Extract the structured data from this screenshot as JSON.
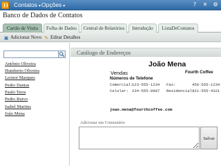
{
  "topbar": {
    "app_icon": "app-icon",
    "menus": [
      {
        "label": "Contatos",
        "caret": "▾"
      },
      {
        "label": "Opções",
        "caret": "▾"
      }
    ],
    "window_icons": [
      "help-icon",
      "close-icon",
      "settings-icon"
    ]
  },
  "app_title": "Banco de Dados de Contatos",
  "tabs": [
    {
      "label": "Cartão de Visita",
      "active": true
    },
    {
      "label": "Folha de Dados",
      "active": false
    },
    {
      "label": "Central de Relatórios",
      "active": false
    },
    {
      "label": "Introdução",
      "active": false
    },
    {
      "label": "ListaDeContatos",
      "active": false
    }
  ],
  "toolbar": {
    "add_new": "Adicionar Novo",
    "edit_details": "Editar Detalhes"
  },
  "search": {
    "value": "",
    "icon": "search-icon"
  },
  "contacts": [
    "Antônio Oliveira",
    "Humberto Oliveira",
    "Leonor Marques",
    "Pedro Dantas",
    "Paulo Terra",
    "Pedro Ruivo",
    "Isabel Martins",
    "João Mena"
  ],
  "catalog": {
    "header": "Catálogo de Endereços",
    "name": "João Mena",
    "job_title": "Vendas",
    "company": "Fourth Coffee",
    "phones_heading": "Números de Telefone",
    "phones": {
      "business_label": "Comercial:",
      "business_value": "123-555-1234",
      "fax_label": "Fax:",
      "fax_value": "456-555-1234",
      "mobile_label": "Celular:",
      "mobile_value": "234-555-0987",
      "home_label": "Residencial:",
      "home_value": "321-555-4321"
    },
    "email": "joao.mena@fourthcoffee.com",
    "comment_label": "Adicionar um Comentário",
    "comment_value": "",
    "save_label": "Salvar"
  },
  "colors": {
    "topbar": "#2f6aa6",
    "active_tab": "#a7c0b2",
    "header_band": "#d5dbd8"
  }
}
